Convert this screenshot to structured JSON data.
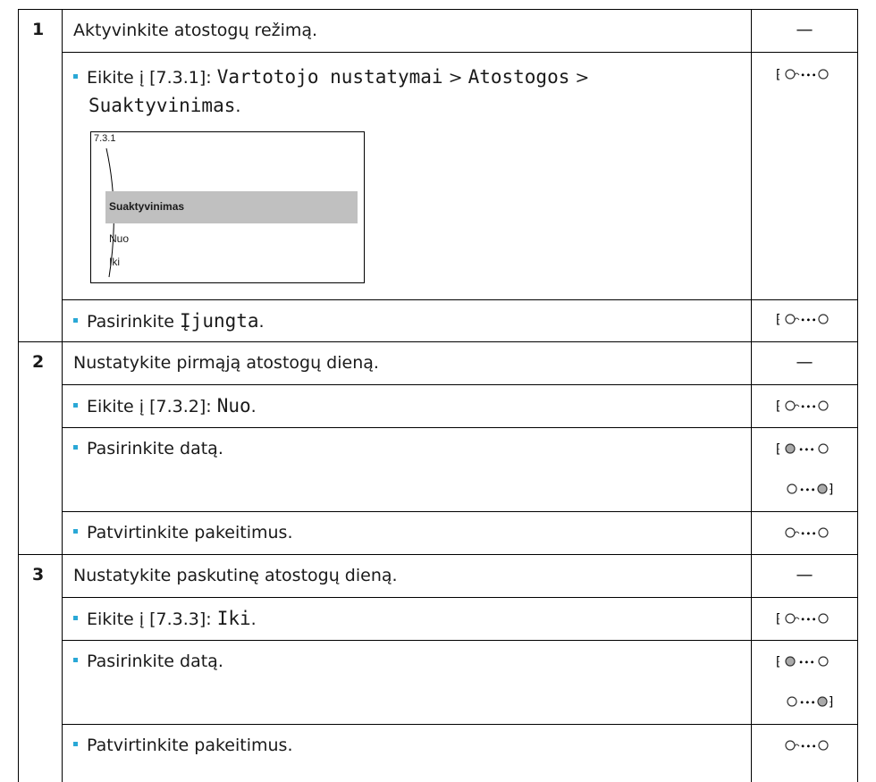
{
  "steps": [
    {
      "number": "1",
      "title": "Aktyvinkite atostogų režimą.",
      "dash": "—",
      "sub": [
        {
          "prefix": "Eikite į [7.3.1]: ",
          "path": [
            "Vartotojo nustatymai",
            "Atostogos",
            "Suaktyvinimas"
          ],
          "sep": ">",
          "end": "."
        },
        {
          "prefix": "Pasirinkite ",
          "mono": "Įjungta",
          "end": "."
        }
      ]
    },
    {
      "number": "2",
      "title": "Nustatykite pirmąją atostogų dieną.",
      "dash": "—",
      "sub": [
        {
          "prefix": "Eikite į [7.3.2]: ",
          "mono": "Nuo",
          "end": "."
        },
        {
          "prefix": "Pasirinkite datą."
        },
        {
          "prefix": "Patvirtinkite pakeitimus."
        }
      ]
    },
    {
      "number": "3",
      "title": "Nustatykite paskutinę atostogų dieną.",
      "dash": "—",
      "sub": [
        {
          "prefix": "Eikite į [7.3.3]: ",
          "mono": "Iki",
          "end": "."
        },
        {
          "prefix": "Pasirinkite datą."
        },
        {
          "prefix": "Patvirtinkite pakeitimus."
        }
      ]
    }
  ],
  "screen": {
    "id": "7.3.1",
    "selected": "Suaktyvinimas",
    "options": [
      "Nuo",
      "Iki"
    ]
  },
  "icons": {
    "dial_turn": "dial-turn-press-icon",
    "dial_left": "left-dial-turn-icon",
    "dial_right": "right-dial-turn-icon",
    "dial_press": "dial-press-icon"
  },
  "colors": {
    "bullet": "#2aa8d6",
    "highlight": "#c0c0c0"
  }
}
